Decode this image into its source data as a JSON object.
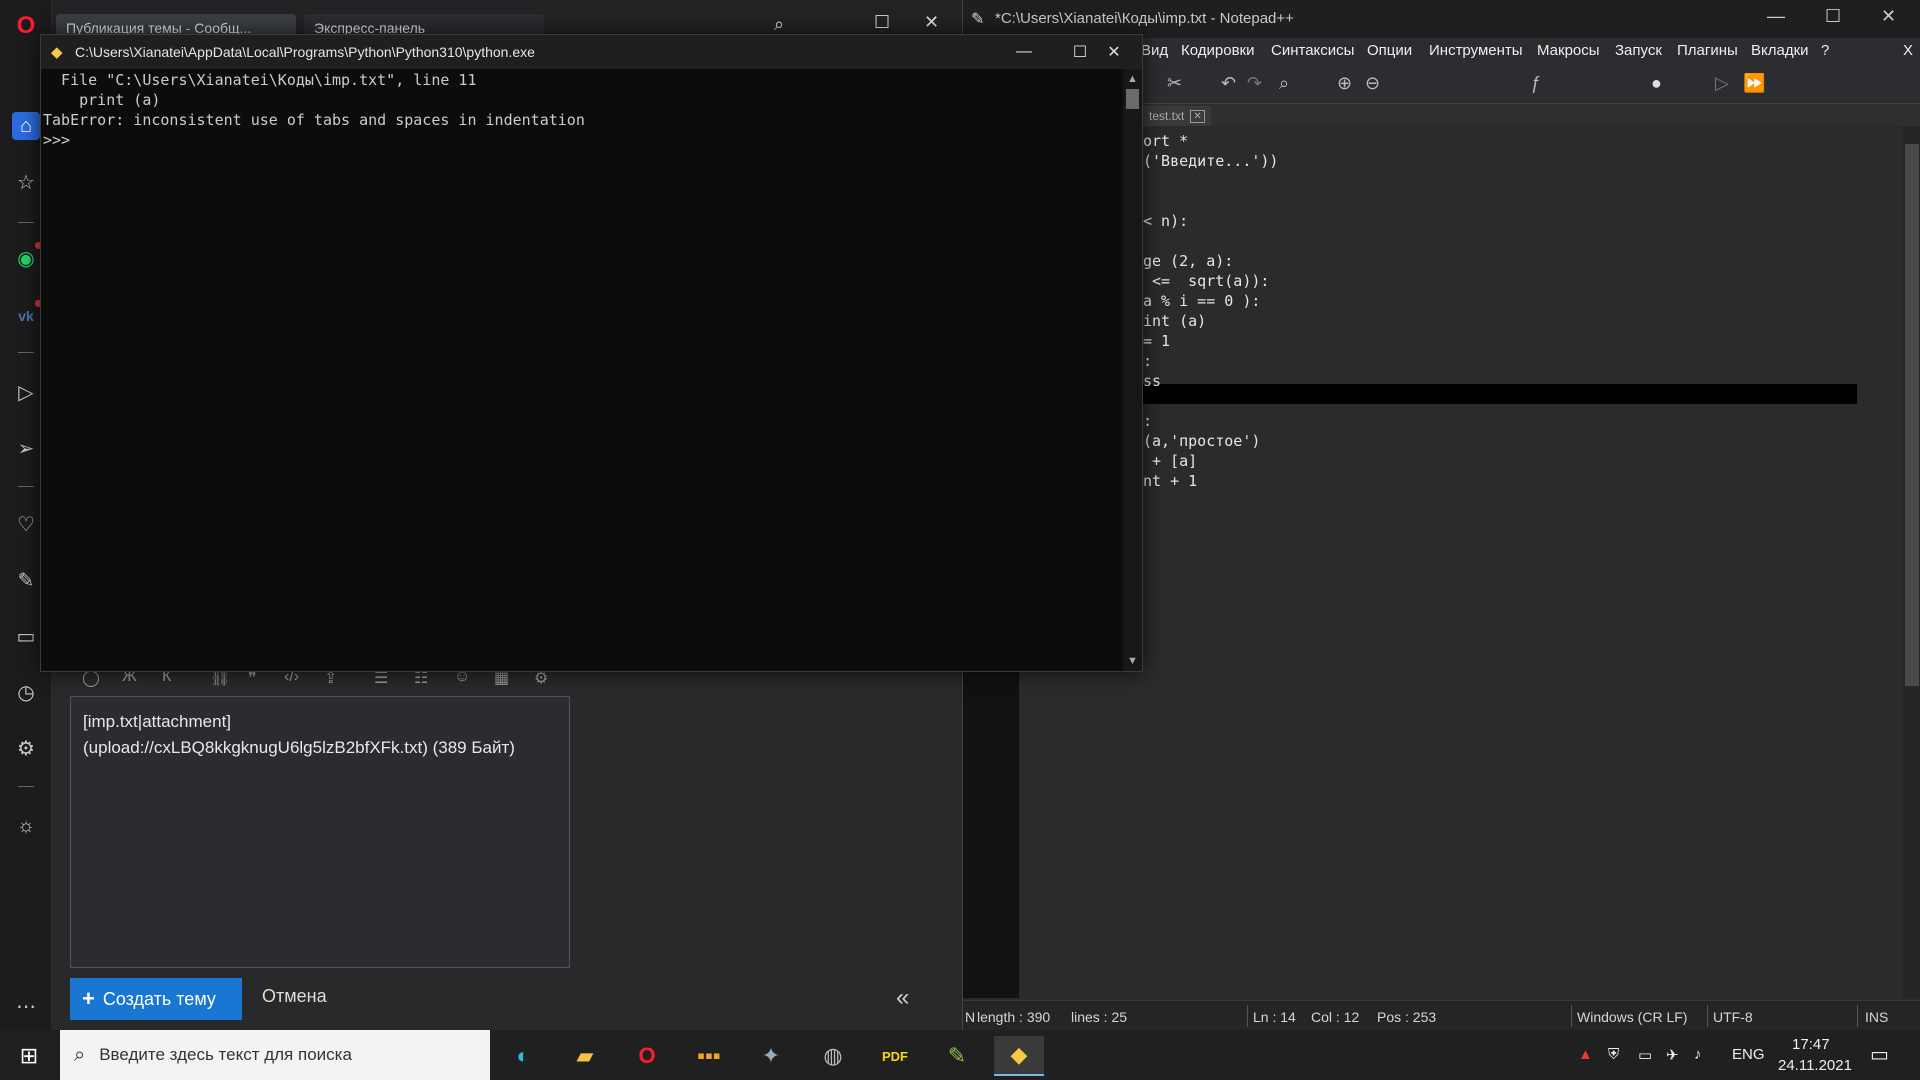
{
  "opera": {
    "tabs": [
      {
        "label": "Публикация темы - Сообщ..."
      },
      {
        "label": "Экспресс-панель"
      }
    ],
    "sidebar_icons": [
      "opera-logo-icon",
      "home-icon",
      "star-icon",
      "whatsapp-icon",
      "vk-icon",
      "player-icon",
      "send-icon",
      "heart-icon",
      "pinboard-icon",
      "tabs-icon",
      "clock-icon",
      "gear-icon",
      "lightbulb-icon",
      "more-icon"
    ],
    "editor": {
      "toolbar": [
        "Ж",
        "К"
      ],
      "content": "[imp.txt|attachment](upload://cxLBQ8kkgknugU6lg5lzB2bfXFk.txt) (389 Байт)",
      "create_label": "Создать тему",
      "cancel_label": "Отмена"
    }
  },
  "console": {
    "title": "C:\\Users\\Xianatei\\AppData\\Local\\Programs\\Python\\Python310\\python.exe",
    "lines": [
      "  File \"C:\\Users\\Xianatei\\Коды\\imp.txt\", line 11",
      "    print (a)",
      "TabError: inconsistent use of tabs and spaces in indentation",
      ">>> "
    ]
  },
  "notepad": {
    "title": "*C:\\Users\\Xianatei\\Коды\\imp.txt - Notepad++",
    "menu": [
      "Вид",
      "Кодировки",
      "Синтаксисы",
      "Опции",
      "Инструменты",
      "Макросы",
      "Запуск",
      "Плагины",
      "Вкладки",
      "?"
    ],
    "menu_close": "X",
    "tab_label": "test.txt",
    "code_lines": [
      "ort *",
      "('Введите...'))",
      "",
      "",
      "< n):",
      "",
      "ge (2, a):",
      " <=  sqrt(a)):",
      "a % i == 0 ):",
      "int (a)",
      "= 1",
      ":",
      "ss",
      "",
      ":",
      "(a,'простое')",
      " + [a]",
      "nt + 1"
    ],
    "status": {
      "length": "length : 390",
      "lines": "lines : 25",
      "ln": "Ln : 14",
      "col": "Col : 12",
      "pos": "Pos : 253",
      "eol": "Windows (CR LF)",
      "encoding": "UTF-8",
      "mode": "INS",
      "prefix": "N"
    }
  },
  "taskbar": {
    "search_placeholder": "Введите здесь текст для поиска",
    "lang": "ENG",
    "time": "17:47",
    "date": "24.11.2021"
  }
}
